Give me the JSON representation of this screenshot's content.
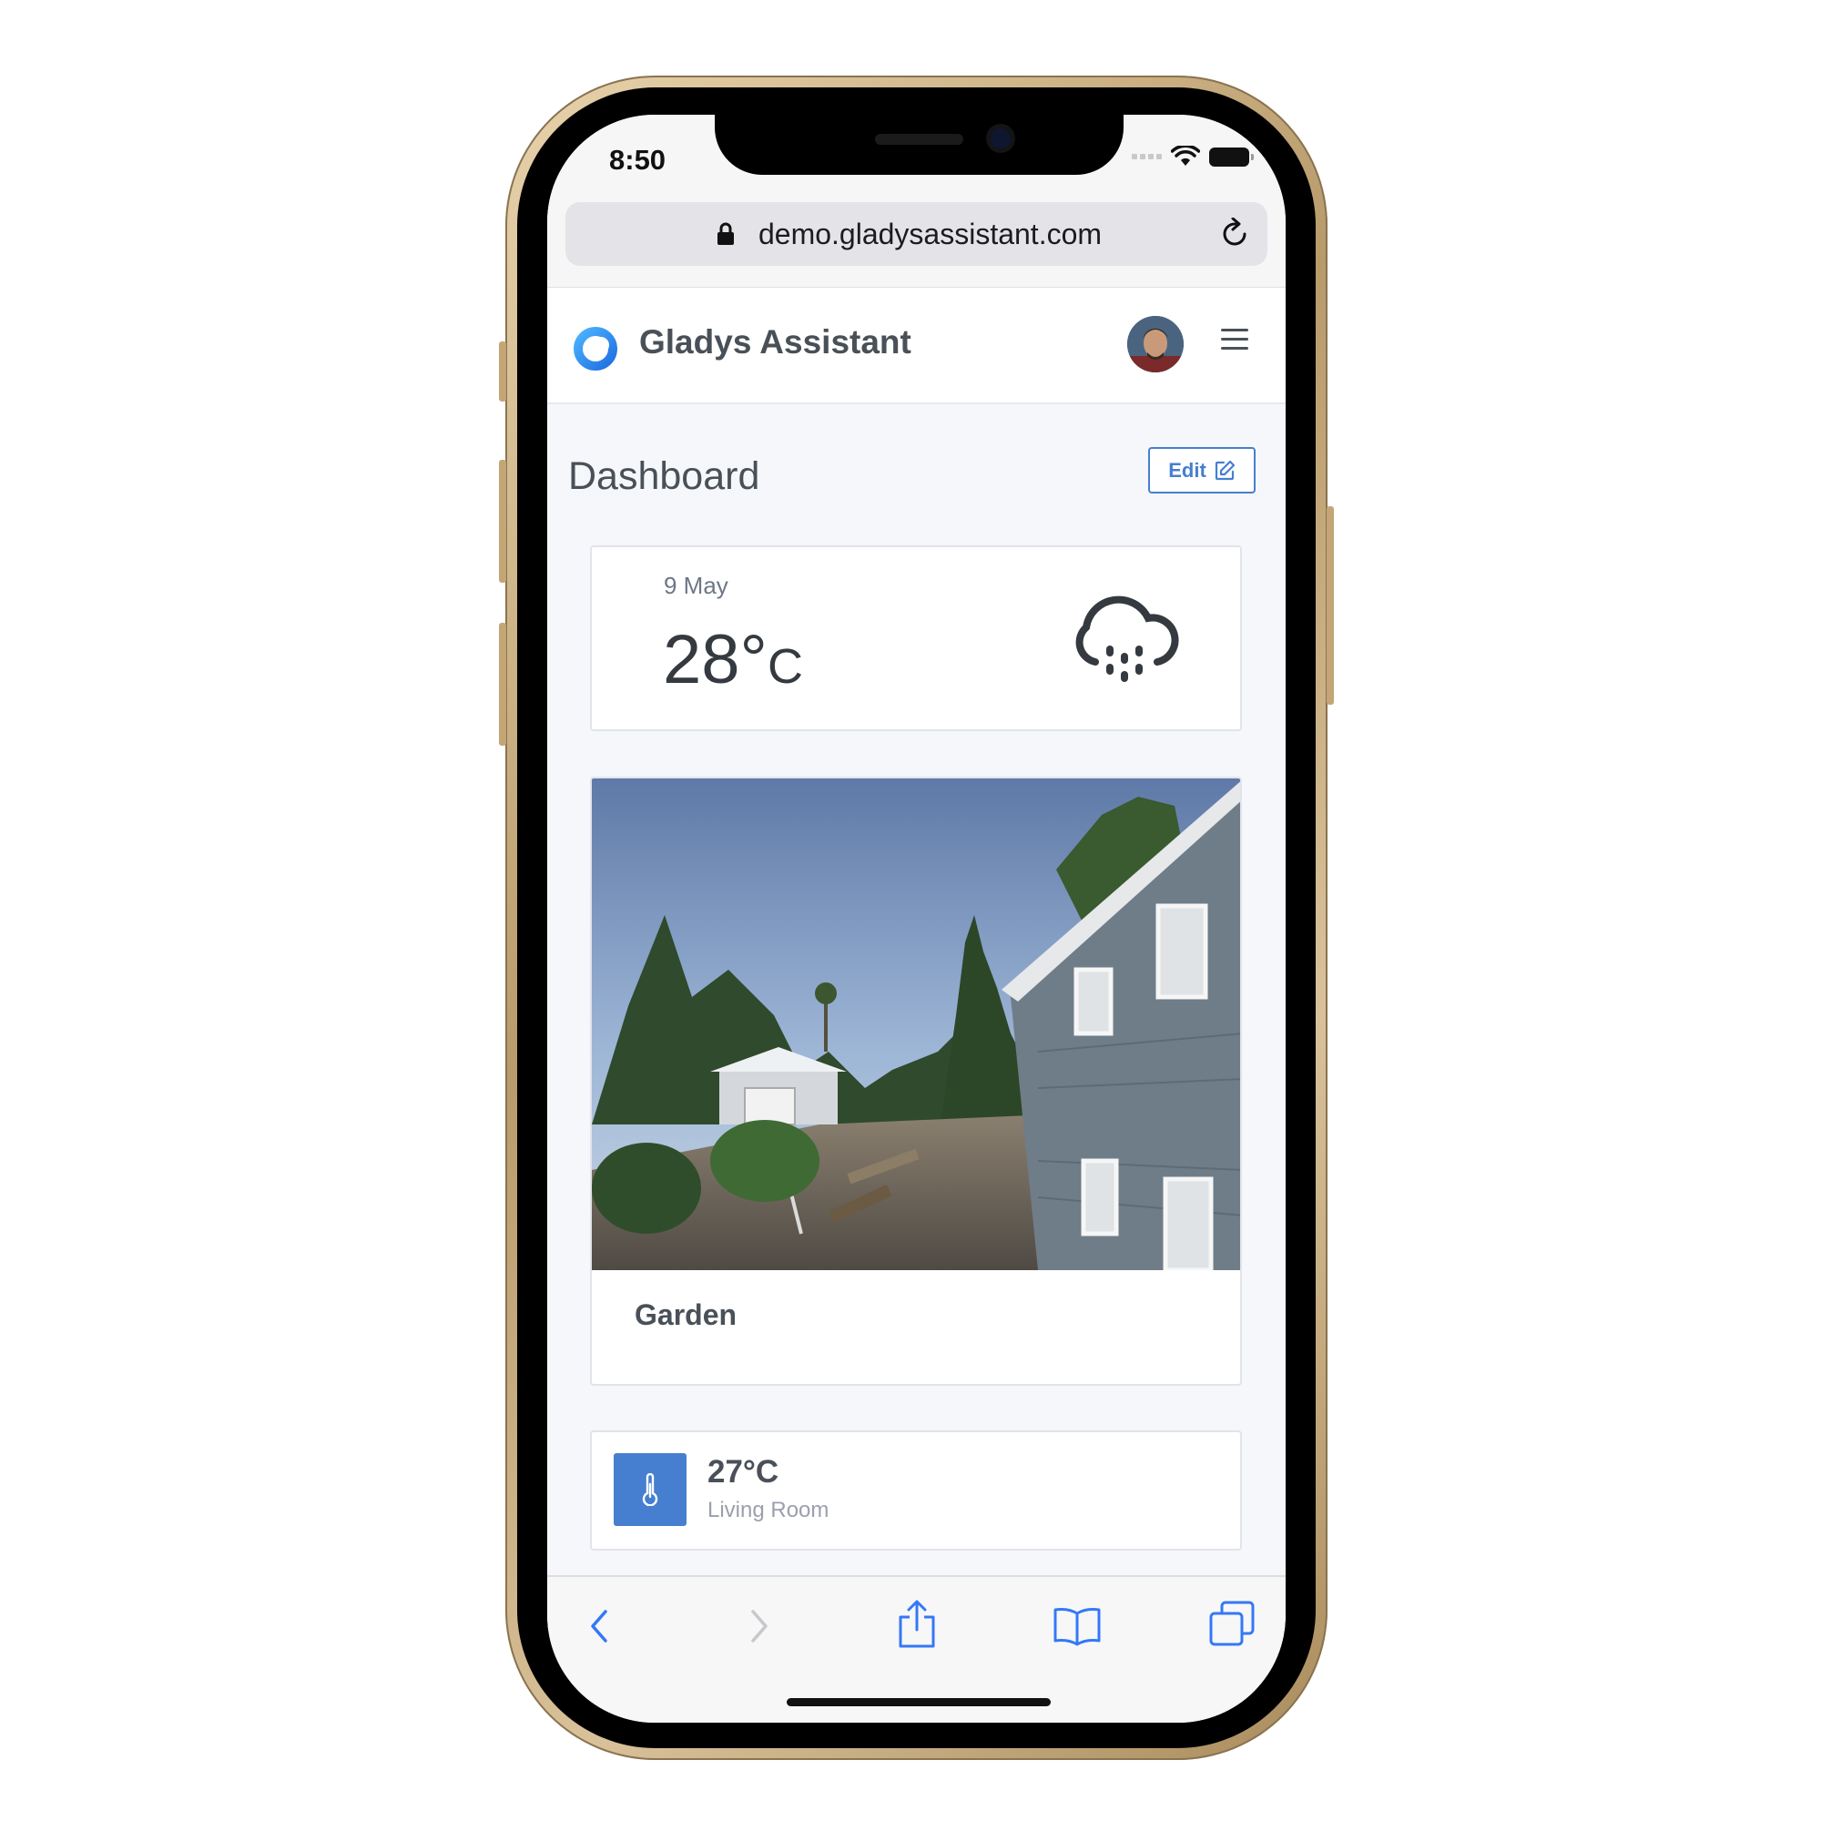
{
  "status_bar": {
    "time": "8:50"
  },
  "browser": {
    "url": "demo.gladysassistant.com"
  },
  "app": {
    "name": "Gladys Assistant"
  },
  "dashboard": {
    "title": "Dashboard",
    "edit_label": "Edit"
  },
  "weather": {
    "date": "9 May",
    "temperature": "28°",
    "unit": "C",
    "icon": "rain-cloud-icon"
  },
  "camera": {
    "name": "Garden"
  },
  "sensor": {
    "value": "27°C",
    "room": "Living Room",
    "icon": "thermometer-icon"
  },
  "colors": {
    "primary": "#467fcf",
    "text": "#495057",
    "muted": "#9aa0ac",
    "background": "#f5f7fb",
    "ios_blue": "#3478f6"
  }
}
